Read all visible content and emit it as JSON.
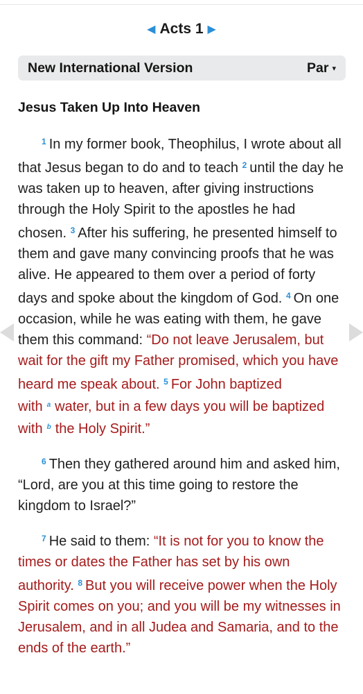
{
  "nav": {
    "chapter_title": "Acts 1",
    "prev_icon": "triangle-left",
    "next_icon": "triangle-right"
  },
  "version_bar": {
    "version_name": "New International Version",
    "parallel_label": "Par",
    "caret": "▾"
  },
  "passage": {
    "heading": "Jesus Taken Up Into Heaven",
    "p1": {
      "v1_num": "1",
      "v1_text": "In my former book, Theophilus, I wrote about all that Jesus began to do and to teach ",
      "v2_num": "2",
      "v2_text": "until the day he was taken up to heaven, after giving instructions through the Holy Spirit to the apostles he had chosen. ",
      "v3_num": "3",
      "v3_text": "After his suffering, he presented himself to them and gave many convincing proofs that he was alive. He appeared to them over a period of forty days and spoke about the kingdom of God. ",
      "v4_num": "4",
      "v4_text": "On one occasion, while he was eating with them, he gave them this command: ",
      "v4_red": "“Do not leave Jerusalem, but wait for the gift my Father promised, which you have heard me speak about. ",
      "v5_num": "5",
      "v5_red_a": "For John baptized with",
      "fn_a": "a",
      "v5_red_b": "water, but in a few days you will be baptized with",
      "fn_b": "b",
      "v5_red_c": "the Holy Spirit.”"
    },
    "p2": {
      "v6_num": "6",
      "v6_text": "Then they gathered around him and asked him, “Lord, are you at this time going to restore the kingdom to Israel?”"
    },
    "p3": {
      "v7_num": "7",
      "v7_text": "He said to them: ",
      "v7_red": "“It is not for you to know the times or dates the Father has set by his own authority. ",
      "v8_num": "8",
      "v8_red": "But you will receive power when the Holy Spirit comes on you; and you will be my witnesses in Jerusalem, and in all Judea and Samaria, and to the ends of the earth.”"
    }
  },
  "colors": {
    "accent_blue": "#2a8fd6",
    "words_of_christ_red": "#a51b1b",
    "version_bar_bg": "#e9eaeb"
  },
  "side_nav": {
    "left_icon": "previous-chapter-arrow",
    "right_icon": "next-chapter-arrow"
  }
}
